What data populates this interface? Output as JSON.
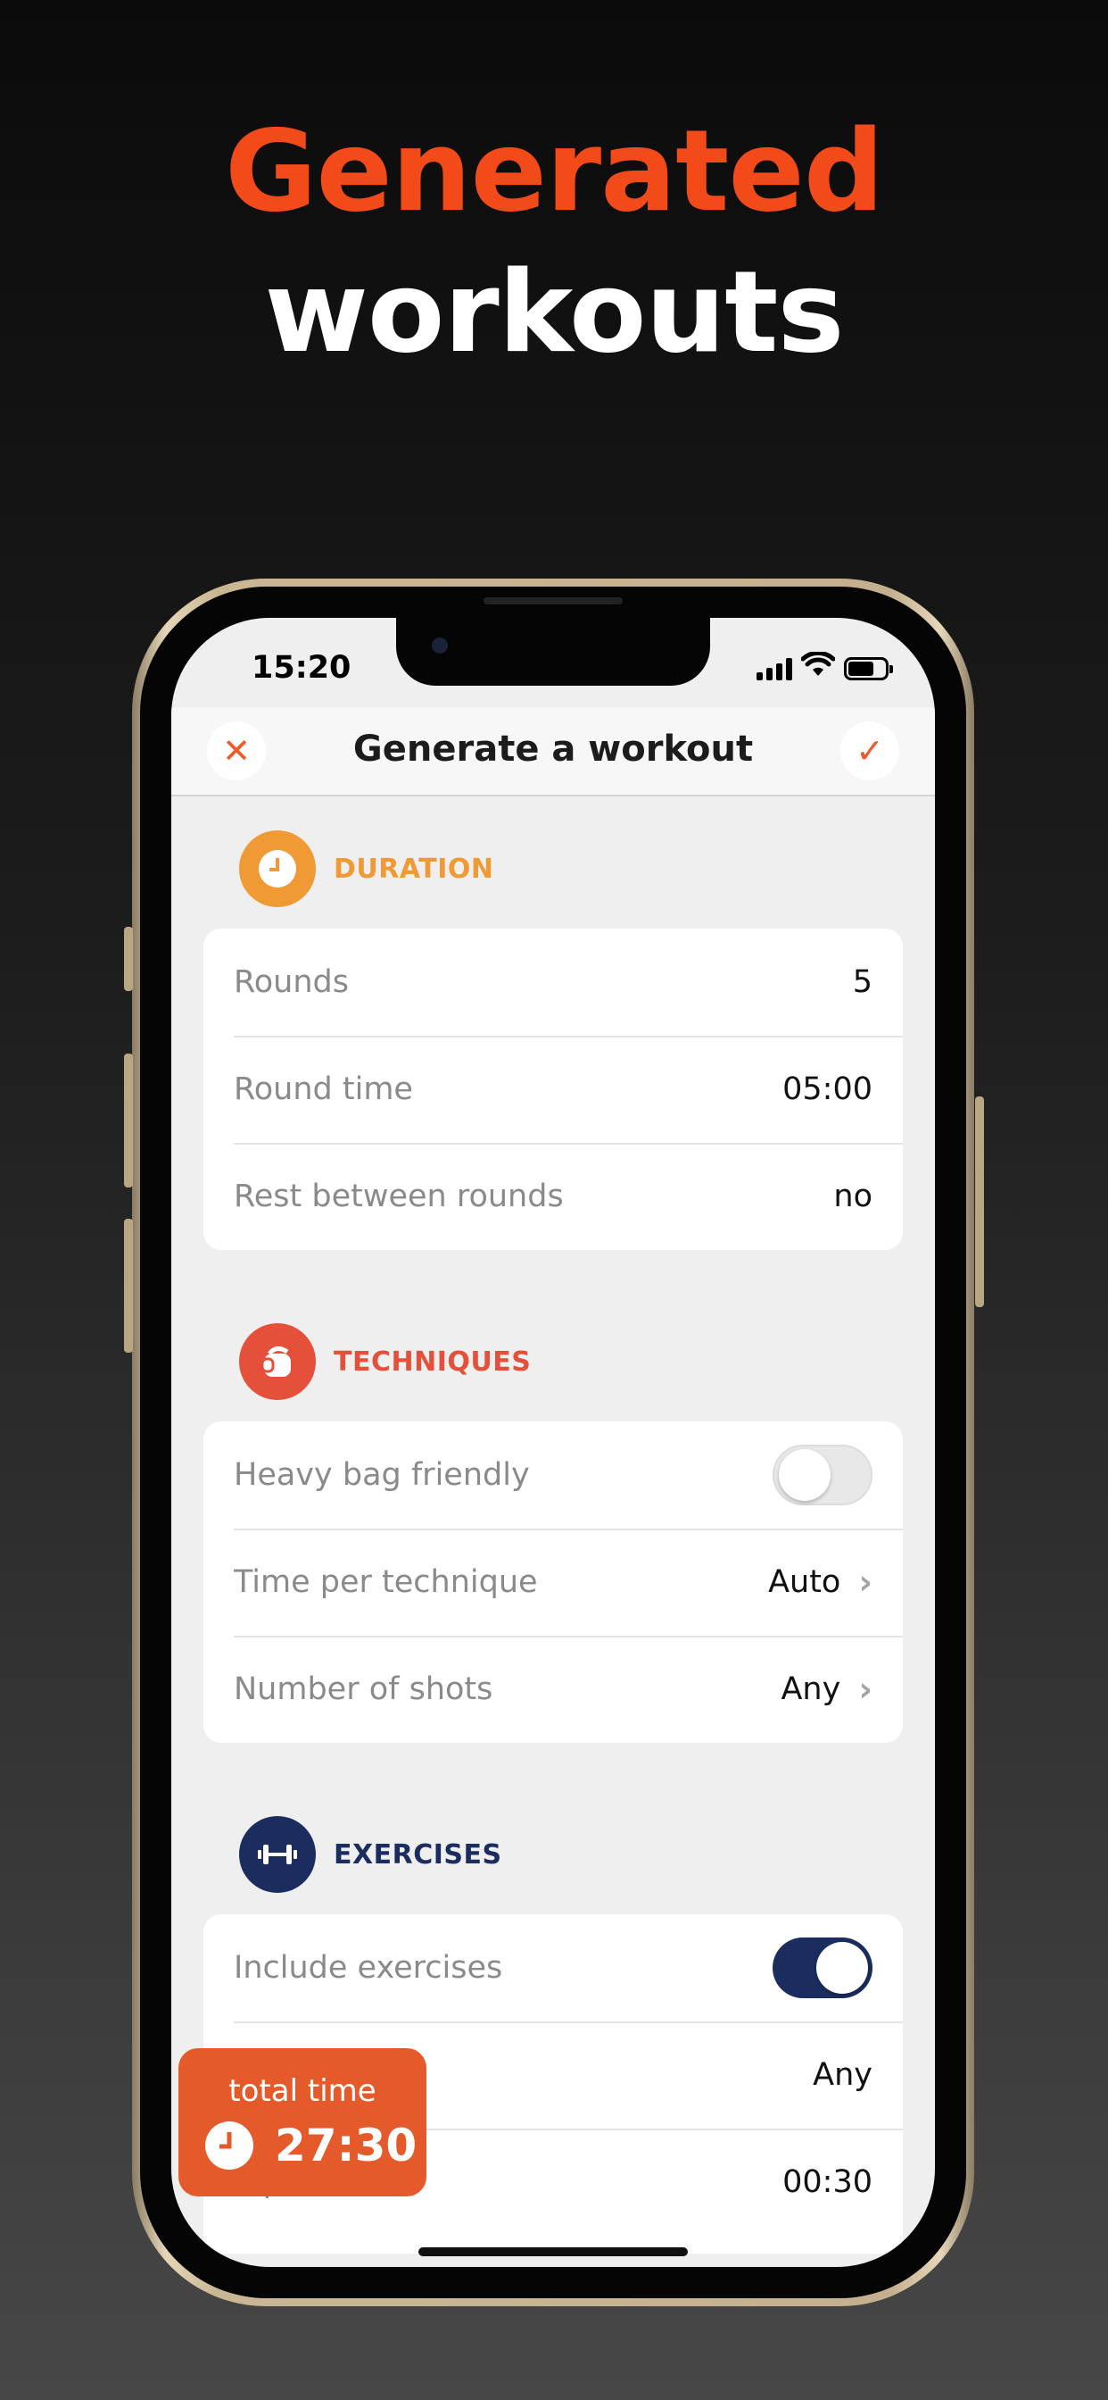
{
  "headline": {
    "line1": "Generated",
    "line2": "workouts"
  },
  "status_bar": {
    "time": "15:20"
  },
  "nav": {
    "title": "Generate a workout",
    "close_icon": "✕",
    "check_icon": "✓"
  },
  "sections": {
    "duration": {
      "label": "DURATION",
      "color": "#f09a35",
      "rows": [
        {
          "label": "Rounds",
          "value": "5"
        },
        {
          "label": "Round time",
          "value": "05:00"
        },
        {
          "label": "Rest between rounds",
          "value": "no"
        }
      ]
    },
    "techniques": {
      "label": "TECHNIQUES",
      "color": "#e5503a",
      "heavy_bag": {
        "label": "Heavy bag friendly",
        "on": false
      },
      "rows": [
        {
          "label": "Time per technique",
          "value": "Auto"
        },
        {
          "label": "Number of shots",
          "value": "Any"
        }
      ]
    },
    "exercises": {
      "label": "EXERCISES",
      "color": "#1a2d5e",
      "include": {
        "label": "Include exercises",
        "on": true
      },
      "rows": [
        {
          "label": "",
          "value": "Any"
        },
        {
          "label": "e per round",
          "value": "00:30"
        }
      ]
    }
  },
  "total_time": {
    "label": "total time",
    "value": "27:30"
  },
  "icons": {
    "duration": "clock-icon",
    "techniques": "boxing-glove-icon",
    "exercises": "dumbbell-icon"
  }
}
